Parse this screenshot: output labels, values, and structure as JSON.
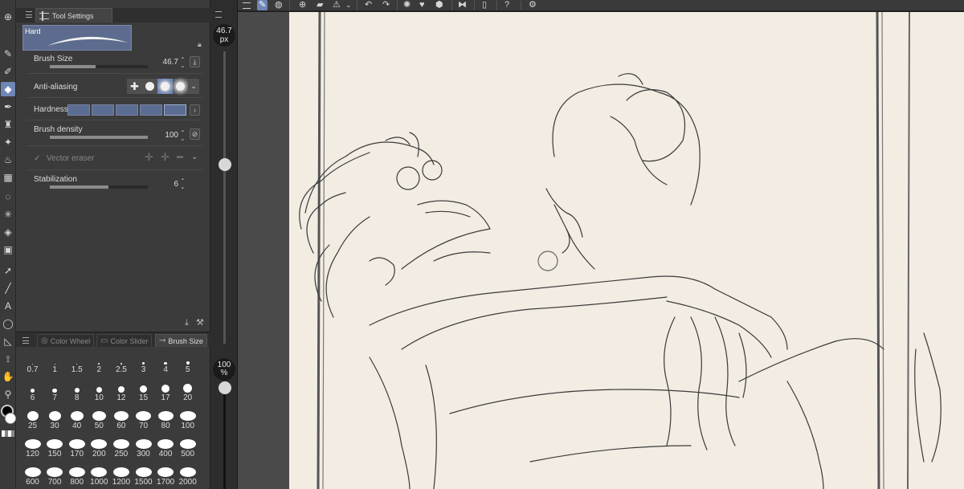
{
  "tool_settings": {
    "tab_label": "Tool Settings",
    "preset_name": "Hard",
    "brush_size": {
      "label": "Brush Size",
      "value": "46.7",
      "level": 0.47
    },
    "anti_aliasing": {
      "label": "Anti-aliasing"
    },
    "hardness": {
      "label": "Hardness",
      "steps": 5
    },
    "brush_density": {
      "label": "Brush density",
      "value": "100",
      "level": 1.0
    },
    "vector_eraser": {
      "label": "Vector eraser",
      "checked": true
    },
    "stabilization": {
      "label": "Stabilization",
      "value": "6",
      "level": 0.6
    }
  },
  "size_strip": {
    "size_value": "46.7",
    "size_unit": "px",
    "opacity_value": "100",
    "opacity_unit": "%"
  },
  "brush_palette": {
    "tabs": [
      {
        "label": "Color Wheel",
        "active": false
      },
      {
        "label": "Color Slider",
        "active": false
      },
      {
        "label": "Brush Size",
        "active": true
      }
    ],
    "sizes": [
      "0.7",
      "1",
      "1.5",
      "2",
      "2.5",
      "3",
      "4",
      "5",
      "6",
      "7",
      "8",
      "10",
      "12",
      "15",
      "17",
      "20",
      "25",
      "30",
      "40",
      "50",
      "60",
      "70",
      "80",
      "100",
      "120",
      "150",
      "170",
      "200",
      "250",
      "300",
      "400",
      "500",
      "600",
      "700",
      "800",
      "1000",
      "1200",
      "1500",
      "1700",
      "2000"
    ]
  },
  "colors": {
    "accent": "#6f87b6",
    "panel": "#3b3b3b",
    "paper": "#f2ece2",
    "main_color": "#000000",
    "sub_color": "#ffffff"
  },
  "icons": {
    "toolstrip": [
      "download-icon",
      "pen-icon",
      "pencil-icon",
      "eraser-icon",
      "brush-icon",
      "airbrush-icon",
      "decoration-icon",
      "blend-icon",
      "frame-icon",
      "lasso-icon",
      "auto-select-icon",
      "fill-icon",
      "gradient-icon",
      "object-icon",
      "line-icon",
      "text-icon",
      "balloon-icon",
      "ruler-icon",
      "correct-line-icon",
      "hand-icon",
      "eyedropper-icon"
    ]
  }
}
